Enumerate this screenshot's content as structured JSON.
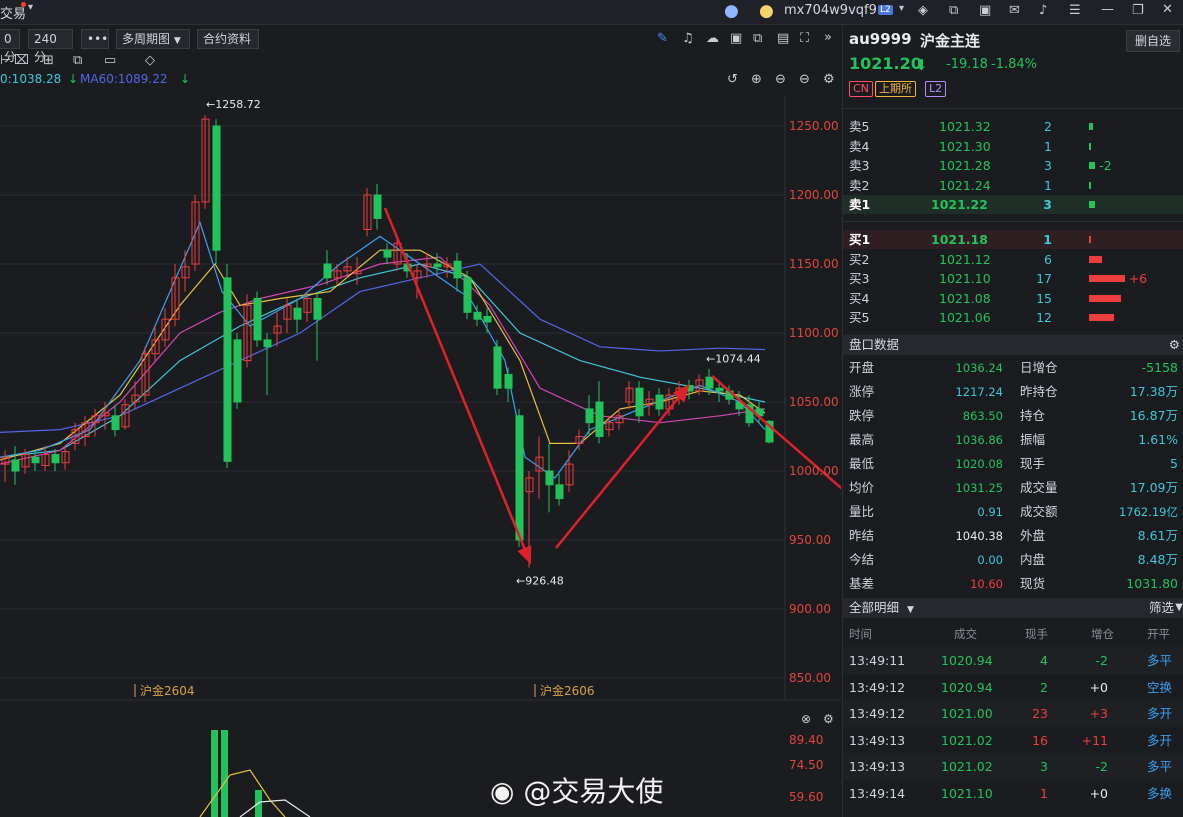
{
  "topbar": {
    "app_name": "交易",
    "account": "mx704w9vqf9",
    "level": "L2"
  },
  "toolbar": {
    "period_partial": "0分",
    "period_240": "240分",
    "more": "•••",
    "multi_period": "多周期图",
    "contract_info": "合约资料"
  },
  "ma": {
    "ma_partial": "0:1038.28",
    "ma60": "MA60:1089.22"
  },
  "chart": {
    "price_ticks": [
      "1250.00",
      "1200.00",
      "1150.00",
      "1100.00",
      "1050.00",
      "1000.00",
      "950.00",
      "900.00",
      "850.00"
    ],
    "high_label": "1258.72",
    "low_label": "926.48",
    "recent_high_label": "1074.44",
    "contract_labels": [
      "沪金2604",
      "沪金2606"
    ],
    "sub_ticks": [
      "89.40",
      "74.50",
      "59.60"
    ]
  },
  "quote": {
    "code": "au9999",
    "name": "沪金主连",
    "delete_button": "删自选",
    "price": "1021.20",
    "change": "-19.18",
    "change_pct": "-1.84%",
    "tags": [
      "CN",
      "上期所",
      "L2"
    ]
  },
  "order_book": {
    "asks": [
      {
        "label": "卖5",
        "price": "1021.32",
        "vol": "2",
        "diff": ""
      },
      {
        "label": "卖4",
        "price": "1021.30",
        "vol": "1",
        "diff": ""
      },
      {
        "label": "卖3",
        "price": "1021.28",
        "vol": "3",
        "diff": "-2"
      },
      {
        "label": "卖2",
        "price": "1021.24",
        "vol": "1",
        "diff": ""
      },
      {
        "label": "卖1",
        "price": "1021.22",
        "vol": "3",
        "diff": ""
      }
    ],
    "bids": [
      {
        "label": "买1",
        "price": "1021.18",
        "vol": "1",
        "diff": ""
      },
      {
        "label": "买2",
        "price": "1021.12",
        "vol": "6",
        "diff": ""
      },
      {
        "label": "买3",
        "price": "1021.10",
        "vol": "17",
        "diff": "+6"
      },
      {
        "label": "买4",
        "price": "1021.08",
        "vol": "15",
        "diff": ""
      },
      {
        "label": "买5",
        "price": "1021.06",
        "vol": "12",
        "diff": ""
      }
    ]
  },
  "panel_header": "盘口数据",
  "stats_left": [
    {
      "k": "开盘",
      "v": "1036.24"
    },
    {
      "k": "涨停",
      "v": "1217.24"
    },
    {
      "k": "跌停",
      "v": "863.50"
    },
    {
      "k": "最高",
      "v": "1036.86"
    },
    {
      "k": "最低",
      "v": "1020.08"
    },
    {
      "k": "均价",
      "v": "1031.25"
    },
    {
      "k": "量比",
      "v": "0.91"
    },
    {
      "k": "昨结",
      "v": "1040.38"
    },
    {
      "k": "今结",
      "v": "0.00"
    },
    {
      "k": "基差",
      "v": "10.60"
    }
  ],
  "stats_right": [
    {
      "k": "日增仓",
      "v": "-5158"
    },
    {
      "k": "昨持仓",
      "v": "17.38万"
    },
    {
      "k": "持仓",
      "v": "16.87万"
    },
    {
      "k": "振幅",
      "v": "1.61%"
    },
    {
      "k": "现手",
      "v": "5"
    },
    {
      "k": "成交量",
      "v": "17.09万"
    },
    {
      "k": "成交额",
      "v": "1762.19亿"
    },
    {
      "k": "外盘",
      "v": "8.61万"
    },
    {
      "k": "内盘",
      "v": "8.48万"
    },
    {
      "k": "现货",
      "v": "1031.80"
    }
  ],
  "trades_header": {
    "title": "全部明细",
    "filter": "筛选"
  },
  "trade_cols": [
    "时间",
    "成交",
    "现手",
    "增仓",
    "开平"
  ],
  "trades": [
    {
      "t": "13:49:11",
      "p": "1020.94",
      "v": "4",
      "d": "-2",
      "type": "多平"
    },
    {
      "t": "13:49:12",
      "p": "1020.94",
      "v": "2",
      "d": "+0",
      "type": "空换"
    },
    {
      "t": "13:49:12",
      "p": "1021.00",
      "v": "23",
      "d": "+3",
      "type": "多开"
    },
    {
      "t": "13:49:13",
      "p": "1021.02",
      "v": "16",
      "d": "+11",
      "type": "多开"
    },
    {
      "t": "13:49:13",
      "p": "1021.02",
      "v": "3",
      "d": "-2",
      "type": "多平"
    },
    {
      "t": "13:49:14",
      "p": "1021.10",
      "v": "1",
      "d": "+0",
      "type": "多换"
    }
  ],
  "watermark": "@交易大使"
}
